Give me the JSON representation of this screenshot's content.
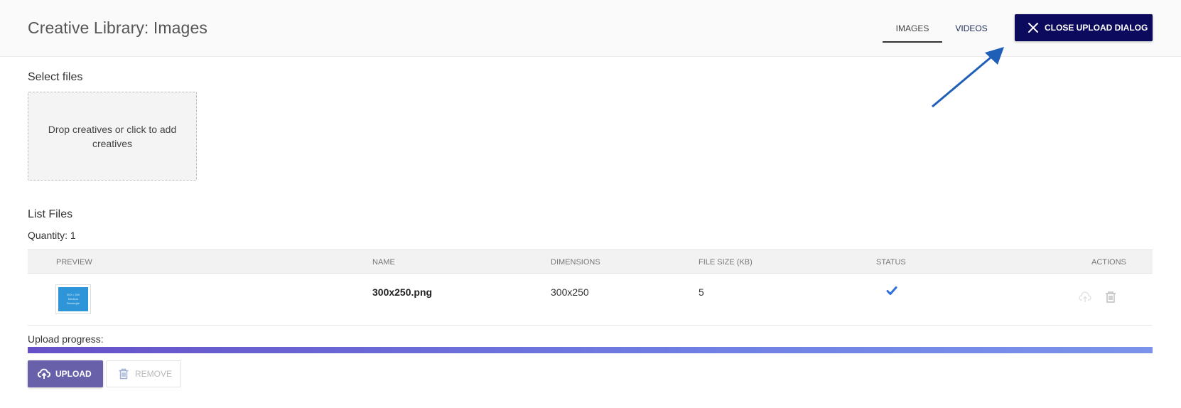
{
  "header": {
    "title": "Creative Library: Images",
    "tabs": [
      {
        "label": "IMAGES",
        "active": true
      },
      {
        "label": "VIDEOS",
        "active": false
      }
    ],
    "close_button_label": "CLOSE UPLOAD DIALOG"
  },
  "select_files": {
    "label": "Select files",
    "dropzone_text": "Drop creatives or click to add creatives"
  },
  "list_files": {
    "label": "List Files",
    "quantity": "Quantity: 1",
    "columns": [
      "PREVIEW",
      "NAME",
      "DIMENSIONS",
      "FILE SIZE (KB)",
      "STATUS",
      "ACTIONS"
    ],
    "rows": [
      {
        "preview_icon": "image-thumbnail",
        "name": "300x250.png",
        "dimensions": "300x250",
        "file_size": "5",
        "status_icon": "check-icon",
        "thumbnail_lines": [
          "300 × 250",
          "Medium",
          "Rectangle"
        ]
      }
    ]
  },
  "upload": {
    "progress_label": "Upload progress:",
    "progress_percent": 100,
    "upload_button_label": "UPLOAD",
    "remove_button_label": "REMOVE"
  },
  "colors": {
    "close_button_bg": "#0c0a5c",
    "upload_button_bg": "#6860a8",
    "progress_start": "#6650c8",
    "progress_end": "#7b93ea",
    "status_check": "#2f6fdb",
    "annotation_arrow": "#1f5fb8"
  }
}
